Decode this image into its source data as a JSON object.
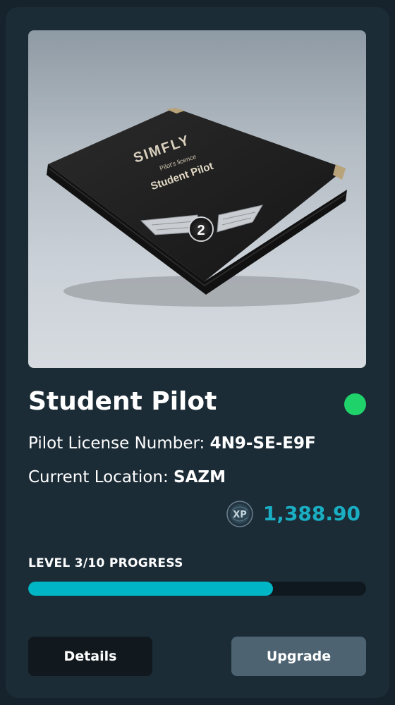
{
  "card": {
    "title": "Student Pilot",
    "status_color": "#1fd26a",
    "image": {
      "icon": "pilot-license-booklet-image",
      "brand": "SIMFLY",
      "subtitle": "Pilot's licence",
      "name": "Student Pilot",
      "badge": "2"
    },
    "license": {
      "label": "Pilot License Number: ",
      "value": "4N9-SE-E9F"
    },
    "location": {
      "label": "Current Location: ",
      "value": "SAZM"
    },
    "xp": {
      "icon": "xp-coin-icon",
      "icon_text": "XP",
      "value": "1,388.90",
      "color": "#1aaec3"
    },
    "progress": {
      "label": "LEVEL 3/10 PROGRESS",
      "fraction": 0.724,
      "color": "#00b6c6"
    },
    "buttons": {
      "details": "Details",
      "upgrade": "Upgrade"
    }
  }
}
